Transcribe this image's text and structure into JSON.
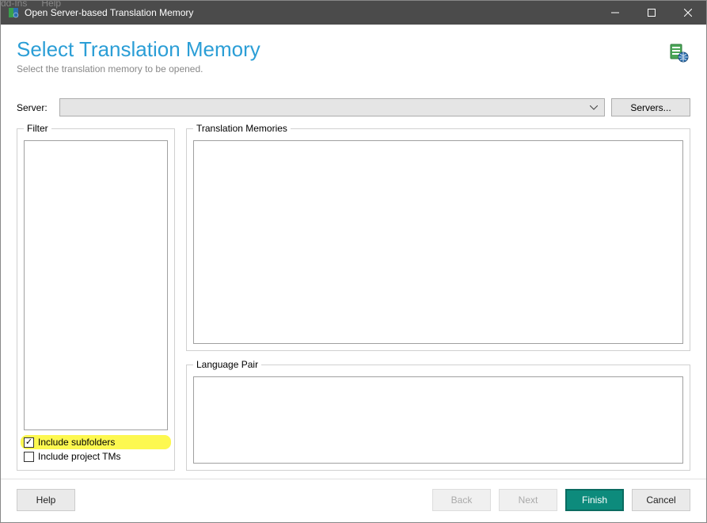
{
  "menubar": {
    "item1": "dd-Ins",
    "item2": "Help"
  },
  "window": {
    "title": "Open Server-based Translation Memory"
  },
  "header": {
    "title": "Select Translation Memory",
    "subtitle": "Select the translation memory to be opened."
  },
  "server": {
    "label": "Server:",
    "value": "",
    "servers_button": "Servers..."
  },
  "filter": {
    "legend": "Filter",
    "include_subfolders_label": "Include subfolders",
    "include_subfolders_checked": true,
    "include_project_tms_label": "Include project TMs",
    "include_project_tms_checked": false
  },
  "tm": {
    "legend": "Translation Memories"
  },
  "lang": {
    "legend": "Language Pair"
  },
  "footer": {
    "help": "Help",
    "back": "Back",
    "next": "Next",
    "finish": "Finish",
    "cancel": "Cancel"
  }
}
